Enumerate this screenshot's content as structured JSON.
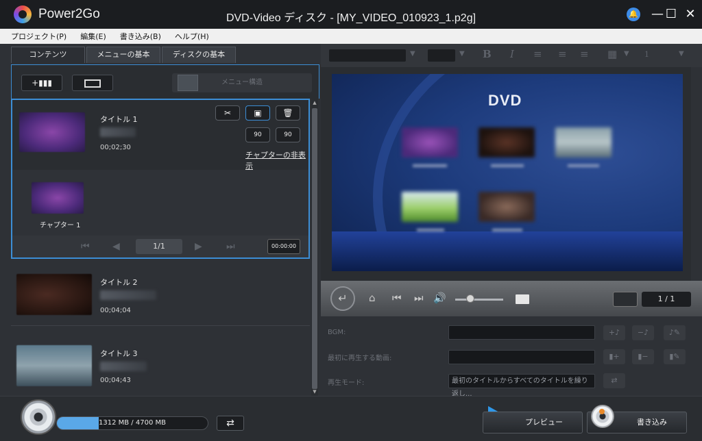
{
  "window": {
    "app_name": "Power2Go",
    "title": "DVD-Video ディスク - [MY_VIDEO_010923_1.p2g]",
    "minimize": "—",
    "maximize": "☐",
    "close": "✕"
  },
  "menubar": [
    {
      "label": "プロジェクト(P)"
    },
    {
      "label": "編集(E)"
    },
    {
      "label": "書き込み(B)"
    },
    {
      "label": "ヘルプ(H)"
    }
  ],
  "left_tabs": [
    {
      "label": "コンテンツ"
    },
    {
      "label": "メニューの基本設定"
    },
    {
      "label": "ディスクの基本設定"
    }
  ],
  "toolbar": {
    "add_video_label": "+▮▮▮",
    "menu_structure_label": "メニュー構造"
  },
  "titles": [
    {
      "label": "タイトル 1",
      "duration": "00;02;30"
    },
    {
      "label": "タイトル 2",
      "duration": "00;04;04"
    },
    {
      "label": "タイトル 3",
      "duration": "00;04;43"
    }
  ],
  "selected_title": {
    "hide_chapters_link": "チャプターの非表示",
    "rotate_left_label": "90",
    "rotate_right_label": "90",
    "chapter_label": "チャプター 1",
    "chapter_page": "1/1",
    "chapter_time": "00:00:00"
  },
  "player": {
    "page_counter": "1 / 1"
  },
  "preview": {
    "dvd_logo": "DVD"
  },
  "settings": {
    "bgm_label": "BGM:",
    "first_play_label": "最初に再生する動画:",
    "play_mode_label": "再生モード:",
    "play_mode_value": "最初のタイトルからすべてのタイトルを繰り返し..."
  },
  "bottom": {
    "capacity_text": "1312 MB / 4700 MB",
    "capacity_used": 0.279,
    "preview_label": "プレビュー",
    "burn_label": "書き込み"
  },
  "colors": {
    "accent": "#3c8ed6",
    "progress": "#5aa8e8",
    "play": "#2f97e8"
  }
}
